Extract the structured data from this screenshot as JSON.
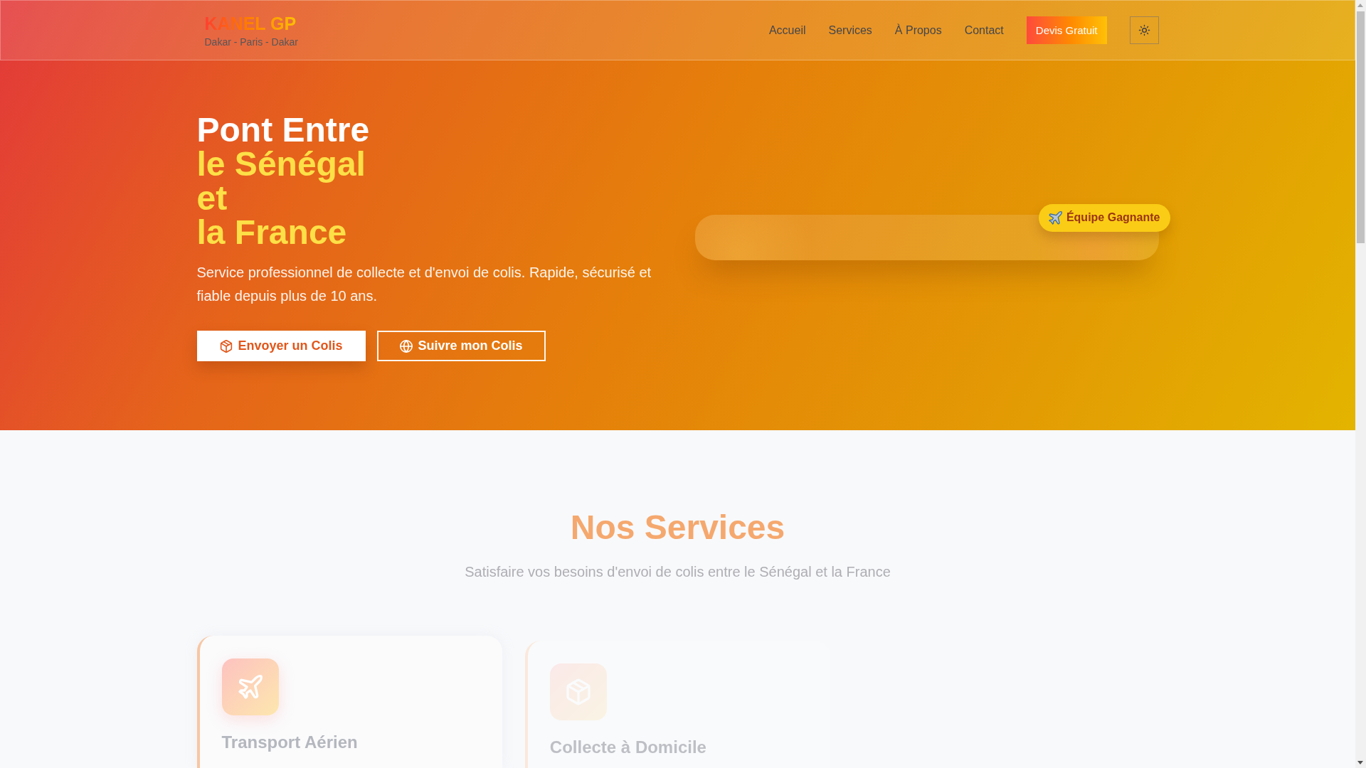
{
  "header": {
    "logo": "KANEL GP",
    "tagline": "Dakar - Paris - Dakar",
    "nav": [
      "Accueil",
      "Services",
      "À Propos",
      "Contact"
    ],
    "cta": "Devis Gratuit"
  },
  "hero": {
    "title_lines": [
      {
        "text": "Pont Entre",
        "highlight": false
      },
      {
        "text": "le Sénégal",
        "highlight": true
      },
      {
        "text": "et",
        "highlight": true
      },
      {
        "text": "la France",
        "highlight": true
      }
    ],
    "description": "Service professionnel de collecte et d'envoi de colis. Rapide, sécurisé et fiable depuis plus de 10 ans.",
    "buttons": [
      {
        "label": "Envoyer un Colis",
        "kind": "primary"
      },
      {
        "label": "Suivre mon Colis",
        "kind": "outline"
      }
    ],
    "badge": "Équipe Gagnante"
  },
  "services": {
    "title": "Nos Services",
    "subtitle": "Satisfaire vos besoins d'envoi de colis entre le Sénégal et la France",
    "cards": [
      {
        "title": "Transport Aérien",
        "kind": "air"
      },
      {
        "title": "Collecte à Domicile",
        "kind": "pickup"
      }
    ]
  }
}
